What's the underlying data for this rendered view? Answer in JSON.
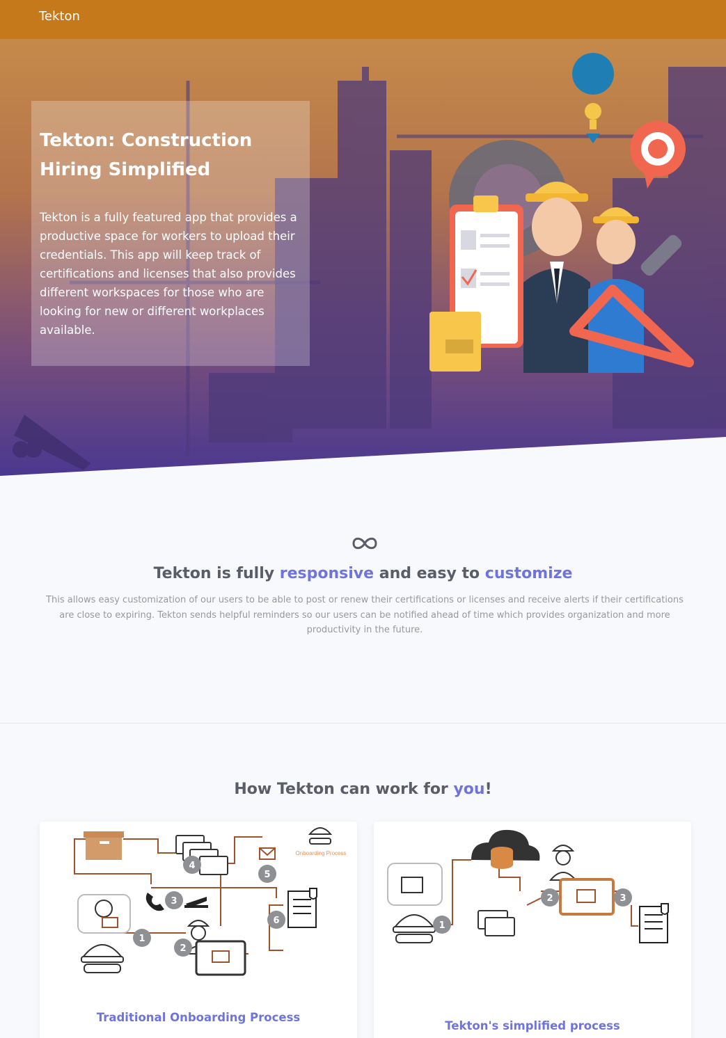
{
  "navbar": {
    "brand": "Tekton"
  },
  "hero": {
    "title": "Tekton: Construction Hiring Simplified",
    "description": "Tekton is a fully featured app that provides a productive space for workers to upload their credentials. This app will keep track of certifications and licenses that also provides different workspaces for those who are looking for new or different workplaces available."
  },
  "feature": {
    "icon": "infinity-icon",
    "title_prefix": "Tekton is fully ",
    "title_accent_1": "responsive",
    "title_mid": " and easy to ",
    "title_accent_2": "customize",
    "text": "This allows easy customization of our users to be able to post or renew their certifications or licenses and receive alerts if their certifications are close to expiring. Tekton sends helpful reminders so our users can be notified ahead of time which provides organization and more productivity in the future."
  },
  "how": {
    "title_prefix": "How Tekton can work for ",
    "title_accent": "you",
    "title_suffix": "!",
    "cards": [
      {
        "title": "Traditional Onboarding Process",
        "diagram_label": "Onboarding Process",
        "steps": [
          "1",
          "2",
          "3",
          "4",
          "5",
          "6"
        ]
      },
      {
        "title": "Tekton's simplified process",
        "steps": [
          "1",
          "2",
          "3"
        ]
      }
    ]
  },
  "colors": {
    "navbar": "#c5791b",
    "accent": "#6f74dd",
    "hero_top": "#c07a3a",
    "hero_bottom": "#4c3a8c"
  }
}
